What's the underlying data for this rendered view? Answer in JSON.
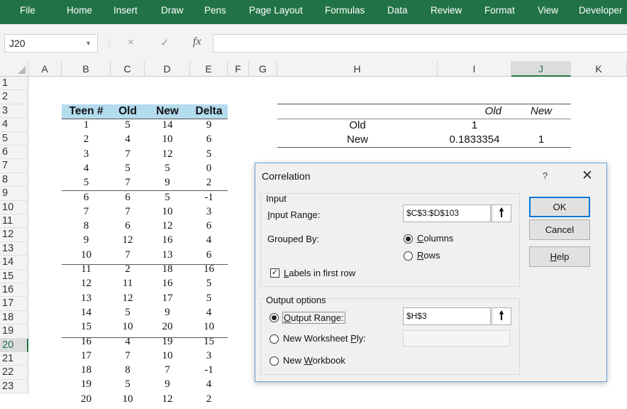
{
  "ribbon": {
    "tabs": [
      "File",
      "Home",
      "Insert",
      "Draw",
      "Pens",
      "Page Layout",
      "Formulas",
      "Data",
      "Review",
      "Format",
      "View",
      "Developer"
    ],
    "color": "#217346"
  },
  "formula_bar": {
    "name_box": "J20",
    "cancel_icon": "×",
    "enter_icon": "✓",
    "fx_label": "fx",
    "formula": ""
  },
  "columns": [
    "A",
    "B",
    "C",
    "D",
    "E",
    "F",
    "G",
    "H",
    "I",
    "J",
    "K"
  ],
  "selected_column": "J",
  "rows": [
    "1",
    "2",
    "3",
    "4",
    "5",
    "6",
    "7",
    "8",
    "9",
    "10",
    "11",
    "12",
    "13",
    "14",
    "15",
    "16",
    "17",
    "18",
    "19",
    "20",
    "21",
    "22",
    "23"
  ],
  "selected_row": "20",
  "table": {
    "headers": [
      "Teen #",
      "Old",
      "New",
      "Delta"
    ],
    "header_fill": "#b4dcef",
    "rows": [
      [
        "1",
        "5",
        "14",
        "9"
      ],
      [
        "2",
        "4",
        "10",
        "6"
      ],
      [
        "3",
        "7",
        "12",
        "5"
      ],
      [
        "4",
        "5",
        "5",
        "0"
      ],
      [
        "5",
        "7",
        "9",
        "2"
      ],
      [
        "6",
        "6",
        "5",
        "-1"
      ],
      [
        "7",
        "7",
        "10",
        "3"
      ],
      [
        "8",
        "6",
        "12",
        "6"
      ],
      [
        "9",
        "12",
        "16",
        "4"
      ],
      [
        "10",
        "7",
        "13",
        "6"
      ],
      [
        "11",
        "2",
        "18",
        "16"
      ],
      [
        "12",
        "11",
        "16",
        "5"
      ],
      [
        "13",
        "12",
        "17",
        "5"
      ],
      [
        "14",
        "5",
        "9",
        "4"
      ],
      [
        "15",
        "10",
        "20",
        "10"
      ],
      [
        "16",
        "4",
        "19",
        "15"
      ],
      [
        "17",
        "7",
        "10",
        "3"
      ],
      [
        "18",
        "8",
        "7",
        "-1"
      ],
      [
        "19",
        "5",
        "9",
        "4"
      ],
      [
        "20",
        "10",
        "12",
        "2"
      ]
    ]
  },
  "correlation_matrix": {
    "col_headers": [
      "Old",
      "New"
    ],
    "rows": [
      {
        "label": "Old",
        "values": [
          "1",
          ""
        ]
      },
      {
        "label": "New",
        "values": [
          "0.1833354",
          "1"
        ]
      }
    ]
  },
  "dialog": {
    "title": "Correlation",
    "help_glyph": "?",
    "close_glyph": "✕",
    "input_section": "Input",
    "input_range_label": "Input Range:",
    "input_range_value": "$C$3:$D$103",
    "grouped_by_label": "Grouped By:",
    "columns_option": "Columns",
    "rows_option": "Rows",
    "labels_checkbox": "Labels in first row",
    "output_section": "Output options",
    "output_range_label": "Output Range:",
    "output_range_value": "$H$3",
    "new_worksheet_label": "New Worksheet Ply:",
    "new_worksheet_value": "",
    "new_workbook_label": "New Workbook",
    "ok_label": "OK",
    "cancel_label": "Cancel",
    "help_label": "Help",
    "ref_icon": "🠕"
  }
}
